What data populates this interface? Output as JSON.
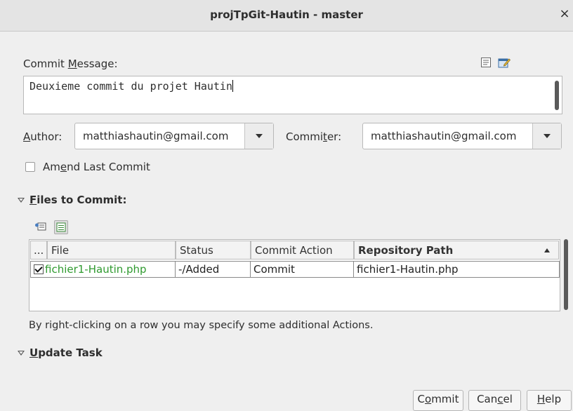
{
  "window": {
    "title": "projTpGit-Hautin - master",
    "close_glyph": "×"
  },
  "commit_message": {
    "label_pre": "Commit ",
    "label_key": "M",
    "label_post": "essage:",
    "value": "Deuxieme commit du projet Hautin",
    "icons": [
      "list-icon",
      "edit-template-icon"
    ]
  },
  "author": {
    "label_key": "A",
    "label_post": "uthor:",
    "value": "matthiashautin@gmail.com"
  },
  "committer": {
    "label_pre": "Commi",
    "label_key": "t",
    "label_post": "er:",
    "value": "matthiashautin@gmail.com"
  },
  "amend": {
    "label_pre": "Am",
    "label_key": "e",
    "label_post": "nd Last Commit",
    "checked": false
  },
  "files_section": {
    "label_key": "F",
    "label_post": "iles to Commit:",
    "toolbar_icons": [
      "diff-icon",
      "select-all-icon"
    ],
    "columns": [
      "...",
      "File",
      "Status",
      "Commit Action",
      "Repository Path"
    ],
    "sorted_column": "Repository Path",
    "rows": [
      {
        "checked": true,
        "file": "fichier1-Hautin.php",
        "status": "-/Added",
        "action": "Commit",
        "path": "fichier1-Hautin.php"
      }
    ],
    "hint": "By right-clicking on a row you may specify some additional Actions."
  },
  "update_task": {
    "label_key": "U",
    "label_post": "pdate Task"
  },
  "buttons": {
    "commit": {
      "pre": "C",
      "key": "o",
      "post": "mmit"
    },
    "cancel": {
      "pre": "Can",
      "key": "c",
      "post": "el"
    },
    "help": {
      "pre": "",
      "key": "H",
      "post": "elp"
    }
  },
  "colors": {
    "added_file": "#2f9a2f",
    "background": "#efefef"
  }
}
